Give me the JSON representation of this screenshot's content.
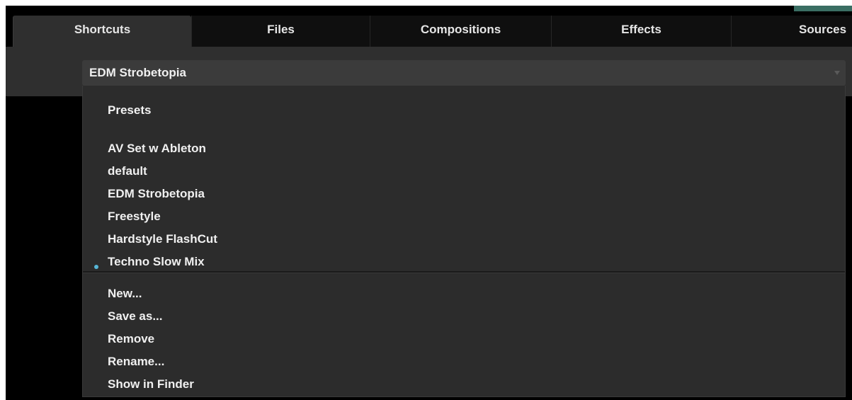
{
  "tabs": [
    {
      "label": "Shortcuts",
      "active": true
    },
    {
      "label": "Files",
      "active": false
    },
    {
      "label": "Compositions",
      "active": false
    },
    {
      "label": "Effects",
      "active": false
    },
    {
      "label": "Sources",
      "active": false
    }
  ],
  "preset_select": {
    "selected": "EDM Strobetopia",
    "icon": "chevron-down-icon"
  },
  "menu": {
    "section_title": "Presets",
    "presets": [
      "AV Set w Ableton",
      "default",
      "EDM Strobetopia",
      "Freestyle",
      "Hardstyle FlashCut",
      "Techno Slow Mix"
    ],
    "selected_preset": "EDM Strobetopia",
    "actions": [
      "New...",
      "Save as...",
      "Remove",
      "Rename...",
      "Show in Finder"
    ]
  },
  "colors": {
    "background": "#000000",
    "panel": "#2f2f2f",
    "menu": "#2c2c2c",
    "text": "#f0f0f0",
    "selected_bullet": "#56b6d6",
    "accent": "#3a6e63"
  }
}
